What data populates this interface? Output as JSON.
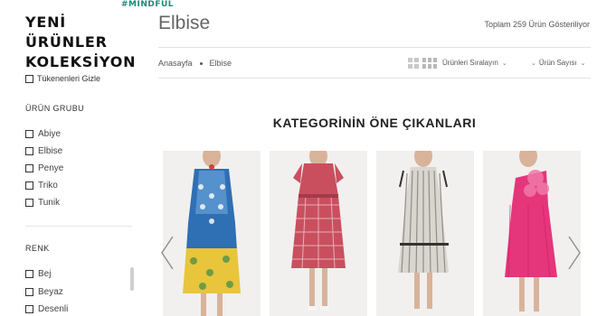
{
  "brand": {
    "tag": "#MINDFUL",
    "title_line1": "YENİ ÜRÜNLER",
    "title_line2": "KOLEKSİYON"
  },
  "filters": {
    "hide_out_of_stock": "Tükenenleri Gizle",
    "group_title": "ÜRÜN GRUBU",
    "groups": [
      "Abiye",
      "Elbise",
      "Penye",
      "Triko",
      "Tunik"
    ],
    "color_title": "RENK",
    "colors": [
      "Bej",
      "Beyaz",
      "Desenli"
    ]
  },
  "header": {
    "title": "Elbise",
    "total": "Toplam 259 Ürün Gösteriliyor"
  },
  "breadcrumb": [
    "Anasayfa",
    "Elbise"
  ],
  "toolbar": {
    "sort_label": "Ürünleri Sıralayın",
    "count_label": "Ürün Sayısı"
  },
  "featured_title": "KATEGORİNİN ÖNE ÇIKANLARI",
  "products": [
    {
      "name": "product-1",
      "colors": [
        "#2f6fb3",
        "#e8c53a"
      ]
    },
    {
      "name": "product-2",
      "colors": [
        "#c94f5f",
        "#f4d8dc"
      ]
    },
    {
      "name": "product-3",
      "colors": [
        "#8f8e86",
        "#d9d6cf"
      ]
    },
    {
      "name": "product-4",
      "colors": [
        "#e5357b",
        "#f07aa8"
      ]
    }
  ]
}
